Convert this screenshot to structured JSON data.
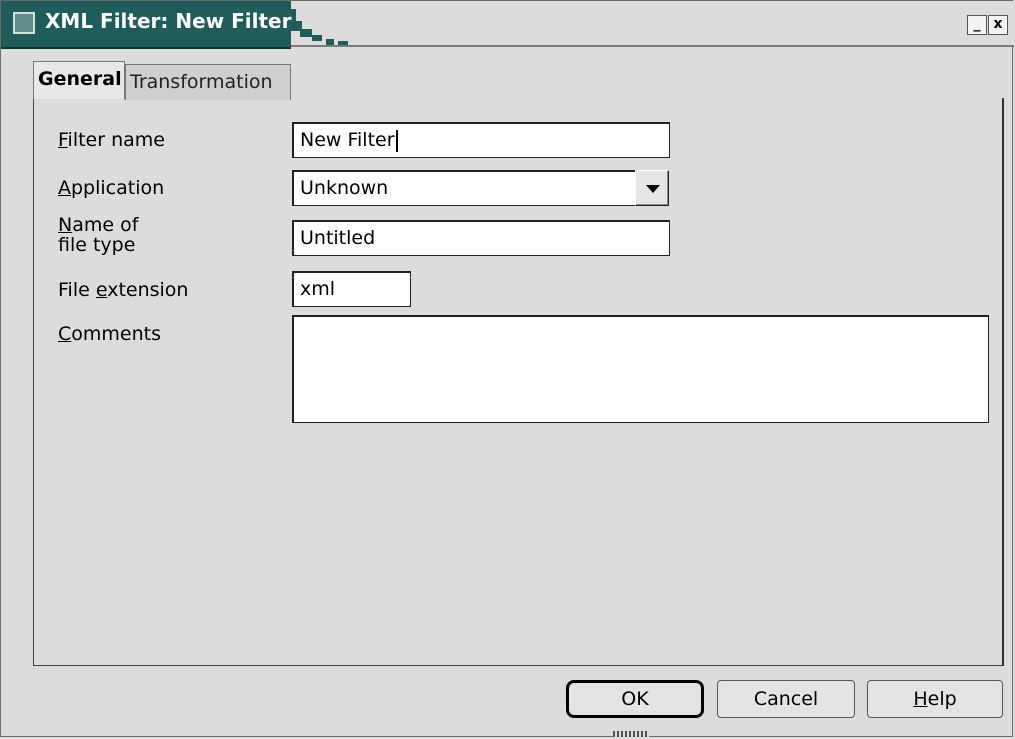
{
  "window": {
    "title": "XML Filter: New Filter"
  },
  "title_buttons": {
    "minimize": "_",
    "close": "x"
  },
  "tabs": [
    {
      "label": "General",
      "active": true
    },
    {
      "label": "Transformation",
      "active": false
    }
  ],
  "form": {
    "filter_name": {
      "label_mnemonic": "F",
      "label_rest": "ilter name",
      "value": "New Filter"
    },
    "application": {
      "label_mnemonic": "A",
      "label_rest": "pplication",
      "value": "Unknown"
    },
    "file_type_name": {
      "label_mnemonic": "N",
      "label_rest": "ame of",
      "label_line2": "file type",
      "value": "Untitled"
    },
    "file_extension": {
      "label_pre": "File ",
      "label_mnemonic": "e",
      "label_rest": "xtension",
      "value": "xml"
    },
    "comments": {
      "label_mnemonic": "C",
      "label_rest": "omments",
      "value": ""
    }
  },
  "buttons": {
    "ok": "OK",
    "cancel": "Cancel",
    "help_mnemonic": "H",
    "help_rest": "elp"
  },
  "colors": {
    "title_accent": "#1f5d5a",
    "dialog_bg": "#dcdcdc"
  }
}
